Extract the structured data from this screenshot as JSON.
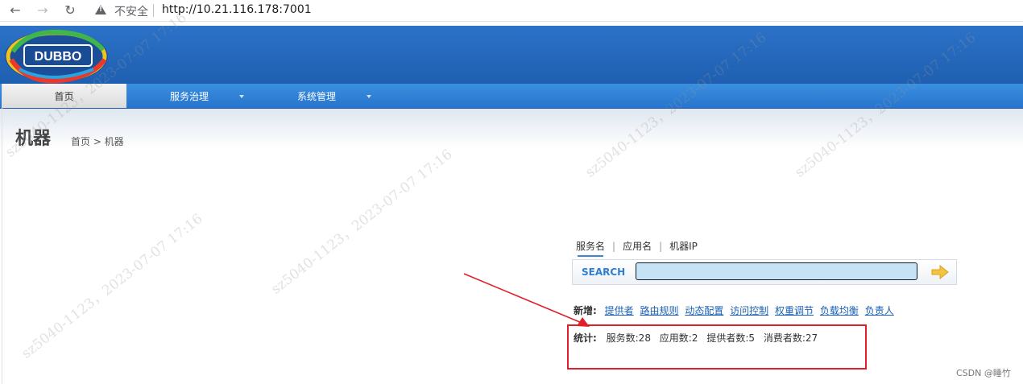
{
  "browser": {
    "back": "←",
    "forward": "→",
    "reload": "↻",
    "insecure_label": "不安全",
    "url": "http://10.21.116.178:7001"
  },
  "app": {
    "logo_text": "DUBBO",
    "nav": [
      {
        "label": "首页",
        "active": true
      },
      {
        "label": "服务治理",
        "dropdown": true
      },
      {
        "label": "系统管理",
        "dropdown": true
      }
    ]
  },
  "page": {
    "title": "机器",
    "breadcrumb": "首页 > 机器"
  },
  "search": {
    "tabs": [
      "服务名",
      "应用名",
      "机器IP"
    ],
    "separator": "|",
    "label": "SEARCH",
    "value": ""
  },
  "quick_links": {
    "label": "新增:",
    "items": [
      "提供者",
      "路由规则",
      "动态配置",
      "访问控制",
      "权重调节",
      "负载均衡",
      "负责人"
    ]
  },
  "stats": {
    "label": "统计:",
    "items": [
      "服务数:28",
      "应用数:2",
      "提供者数:5",
      "消费者数:27"
    ]
  },
  "watermark": "sz5040-1123，2023-07-07 17:16",
  "footer_credit": "CSDN @睡竹",
  "colors": {
    "header_blue": "#1e5fb0",
    "highlight_red": "#e01f2a",
    "link_blue": "#1a5fb4"
  }
}
